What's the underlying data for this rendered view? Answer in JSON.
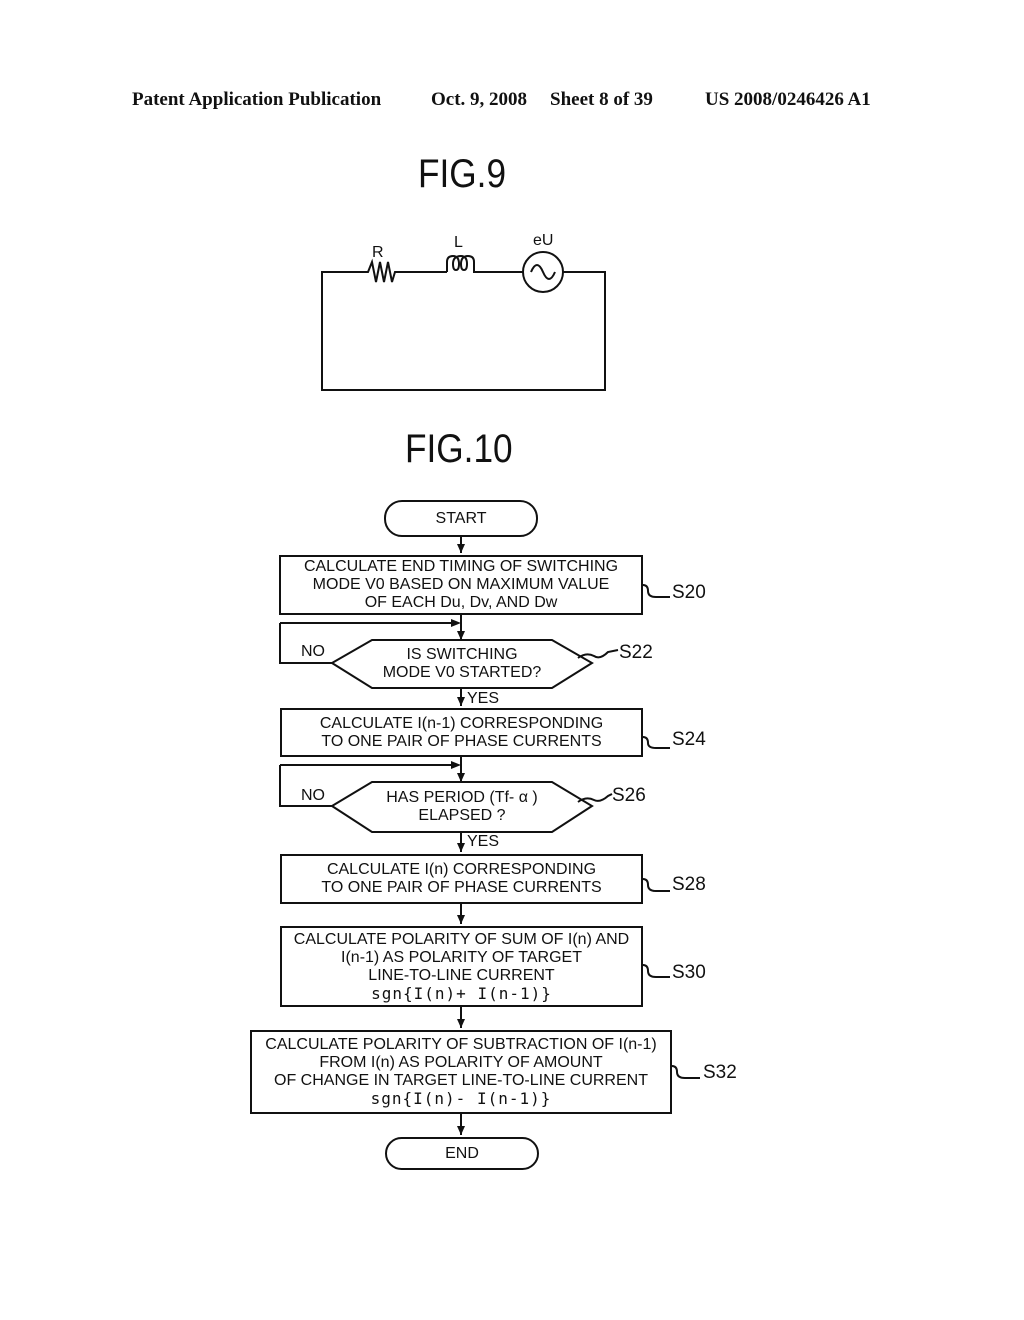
{
  "header": {
    "publication": "Patent Application Publication",
    "date": "Oct. 9, 2008",
    "sheet": "Sheet 8 of 39",
    "number": "US 2008/0246426 A1"
  },
  "fig9": {
    "title": "FIG.9",
    "components": {
      "resistor": "R",
      "inductor": "L",
      "source": "eU"
    }
  },
  "fig10": {
    "title": "FIG.10",
    "start": "START",
    "end": "END",
    "steps": [
      {
        "id": "S20",
        "type": "process",
        "lines": [
          "CALCULATE END TIMING  OF SWITCHING",
          "MODE V0 BASED ON MAXIMUM VALUE",
          "OF EACH Du, Dv, AND Dw"
        ]
      },
      {
        "id": "S22",
        "type": "decision",
        "lines": [
          "IS SWITCHING",
          "MODE V0 STARTED?"
        ],
        "no": "NO",
        "yes": "YES"
      },
      {
        "id": "S24",
        "type": "process",
        "lines": [
          "CALCULATE  I(n-1) CORRESPONDING",
          "TO ONE PAIR OF PHASE CURRENTS"
        ]
      },
      {
        "id": "S26",
        "type": "decision",
        "lines": [
          "HAS PERIOD (Tf- α )",
          "ELAPSED ?"
        ],
        "no": "NO",
        "yes": "YES"
      },
      {
        "id": "S28",
        "type": "process",
        "lines": [
          "CALCULATE  I(n) CORRESPONDING",
          "TO ONE PAIR OF PHASE CURRENTS"
        ]
      },
      {
        "id": "S30",
        "type": "process",
        "lines": [
          "CALCULATE POLARITY OF SUM OF I(n) AND",
          "I(n-1) AS POLARITY OF TARGET",
          "LINE-TO-LINE CURRENT"
        ],
        "formula": "sgn{I(n)+ I(n-1)}"
      },
      {
        "id": "S32",
        "type": "process",
        "lines": [
          "CALCULATE POLARITY OF SUBTRACTION  OF I(n-1)",
          "FROM  I(n) AS POLARITY OF AMOUNT",
          "OF CHANGE IN TARGET LINE-TO-LINE CURRENT"
        ],
        "formula": "sgn{I(n)- I(n-1)}"
      }
    ]
  }
}
